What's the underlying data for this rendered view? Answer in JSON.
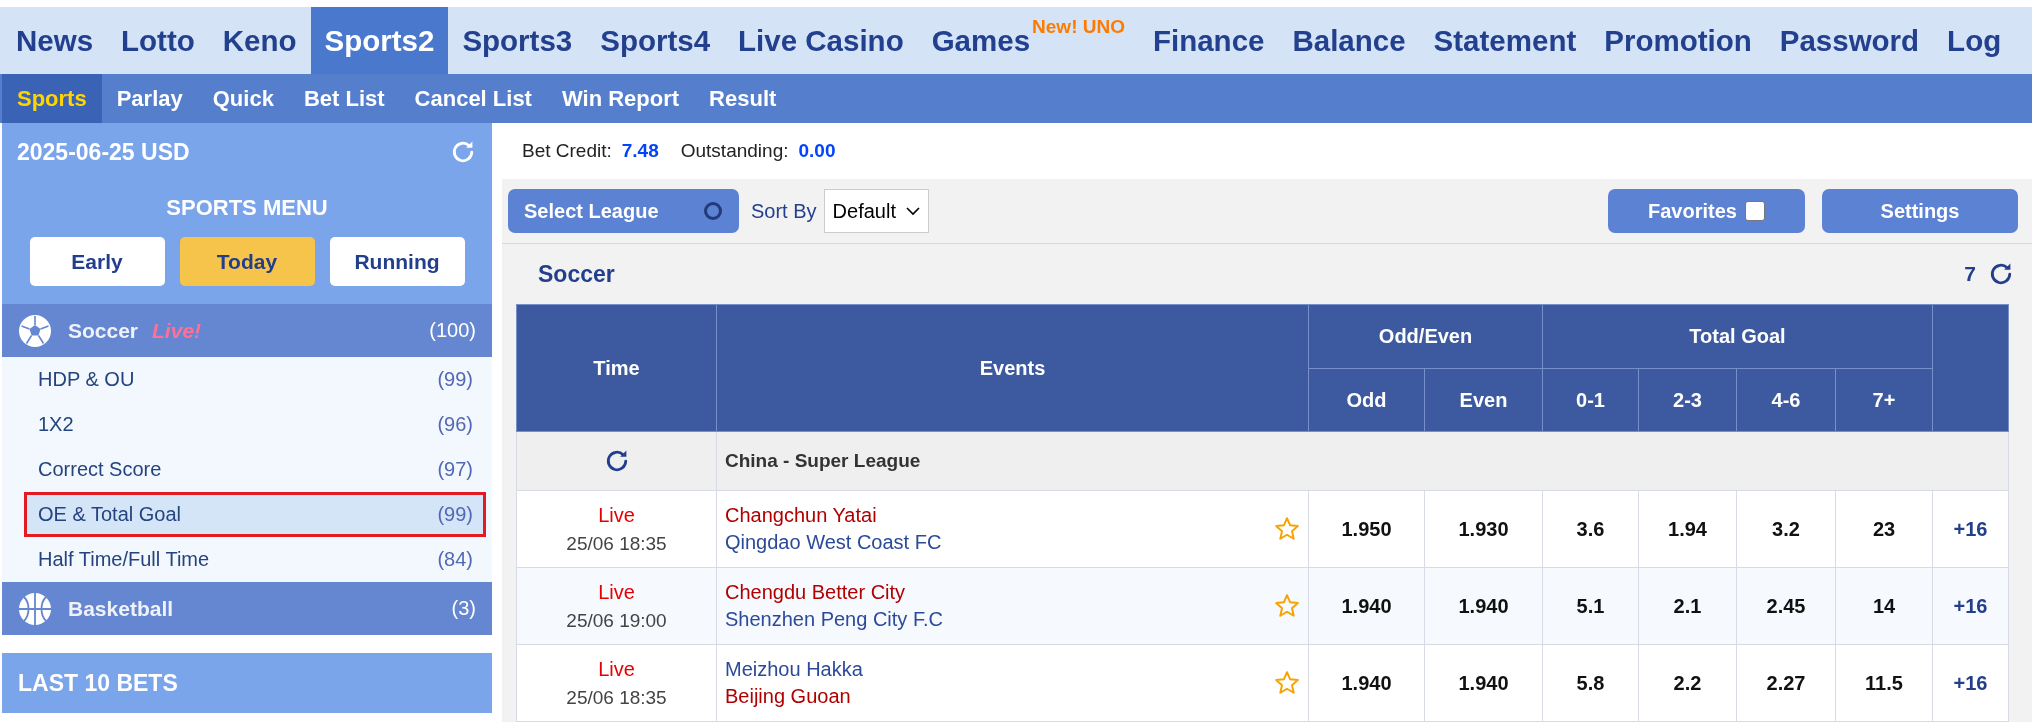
{
  "top_nav": [
    {
      "label": "News",
      "selected": false
    },
    {
      "label": "Lotto",
      "selected": false
    },
    {
      "label": "Keno",
      "selected": false
    },
    {
      "label": "Sports2",
      "selected": true
    },
    {
      "label": "Sports3",
      "selected": false
    },
    {
      "label": "Sports4",
      "selected": false
    },
    {
      "label": "Live Casino",
      "selected": false
    },
    {
      "label": "Games",
      "selected": false,
      "badge": "New! UNO"
    },
    {
      "label": "Finance",
      "selected": false
    },
    {
      "label": "Balance",
      "selected": false
    },
    {
      "label": "Statement",
      "selected": false
    },
    {
      "label": "Promotion",
      "selected": false
    },
    {
      "label": "Password",
      "selected": false
    },
    {
      "label": "Log",
      "selected": false
    }
  ],
  "sub_nav": [
    {
      "label": "Sports",
      "selected": true
    },
    {
      "label": "Parlay",
      "selected": false
    },
    {
      "label": "Quick",
      "selected": false
    },
    {
      "label": "Bet List",
      "selected": false
    },
    {
      "label": "Cancel List",
      "selected": false
    },
    {
      "label": "Win Report",
      "selected": false
    },
    {
      "label": "Result",
      "selected": false
    }
  ],
  "sidebar": {
    "date": "2025-06-25 USD",
    "menu_title": "SPORTS MENU",
    "periods": [
      {
        "label": "Early",
        "selected": false
      },
      {
        "label": "Today",
        "selected": true
      },
      {
        "label": "Running",
        "selected": false
      }
    ],
    "sports": [
      {
        "kind": "soccer",
        "name": "Soccer",
        "live": "Live!",
        "count": "(100)",
        "items": [
          {
            "label": "HDP & OU",
            "count": "(99)",
            "selected": false
          },
          {
            "label": "1X2",
            "count": "(96)",
            "selected": false
          },
          {
            "label": "Correct Score",
            "count": "(97)",
            "selected": false
          },
          {
            "label": "OE & Total Goal",
            "count": "(99)",
            "selected": true
          },
          {
            "label": "Half Time/Full Time",
            "count": "(84)",
            "selected": false
          }
        ]
      },
      {
        "kind": "basketball",
        "name": "Basketball",
        "count": "(3)"
      }
    ],
    "last_bets_title": "LAST 10 BETS"
  },
  "credit": {
    "bet_credit_label": "Bet Credit:",
    "bet_credit": "7.48",
    "outstanding_label": "Outstanding:",
    "outstanding": "0.00"
  },
  "toolbar": {
    "select_league": "Select League",
    "sort_label": "Sort By",
    "sort_value": "Default",
    "favorites": "Favorites",
    "favorites_checked": false,
    "settings": "Settings"
  },
  "section": {
    "title": "Soccer",
    "count": "7"
  },
  "table": {
    "time_header": "Time",
    "events_header": "Events",
    "groups": [
      {
        "label": "Odd/Even",
        "columns": [
          "Odd",
          "Even"
        ]
      },
      {
        "label": "Total Goal",
        "columns": [
          "0-1",
          "2-3",
          "4-6",
          "7+"
        ]
      }
    ],
    "league": "China - Super League",
    "rows": [
      {
        "status": "Live",
        "time": "25/06 18:35",
        "teams": [
          {
            "name": "Changchun Yatai",
            "favored": true
          },
          {
            "name": "Qingdao West Coast FC",
            "favored": false
          }
        ],
        "starred": false,
        "odds": [
          "1.950",
          "1.930",
          "3.6",
          "1.94",
          "3.2",
          "23"
        ],
        "more": "+16"
      },
      {
        "status": "Live",
        "time": "25/06 19:00",
        "teams": [
          {
            "name": "Chengdu Better City",
            "favored": true
          },
          {
            "name": "Shenzhen Peng City F.C",
            "favored": false
          }
        ],
        "starred": false,
        "odds": [
          "1.940",
          "1.940",
          "5.1",
          "2.1",
          "2.45",
          "14"
        ],
        "more": "+16"
      },
      {
        "status": "Live",
        "time": "25/06 18:35",
        "teams": [
          {
            "name": "Meizhou Hakka",
            "favored": false
          },
          {
            "name": "Beijing Guoan",
            "favored": true
          }
        ],
        "starred": false,
        "odds": [
          "1.940",
          "1.940",
          "5.8",
          "2.2",
          "2.27",
          "11.5"
        ],
        "more": "+16"
      }
    ]
  }
}
